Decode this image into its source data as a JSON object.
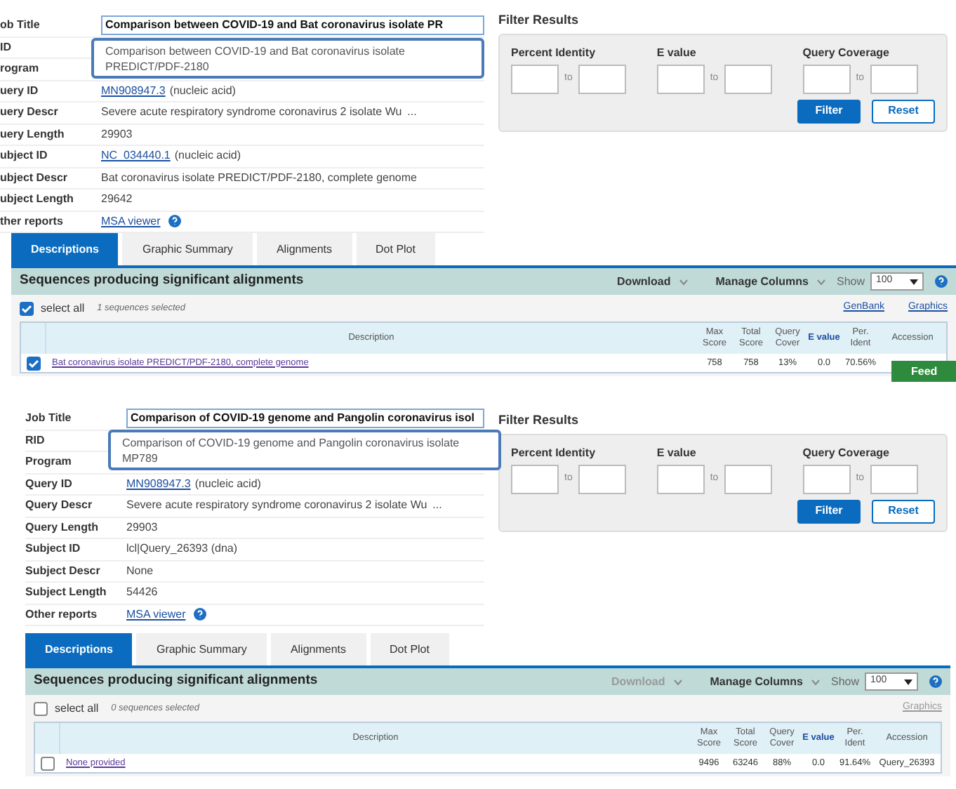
{
  "panels": [
    {
      "details": [
        {
          "label": "ob Title",
          "kind": "input",
          "value": "Comparison between COVID-19 and Bat coronavirus isolate PR"
        },
        {
          "label": "ID",
          "kind": "none"
        },
        {
          "label": "rogram",
          "kind": "none"
        },
        {
          "label": "uery ID",
          "kind": "link",
          "value": "MN908947.3",
          "suffix": "(nucleic acid)"
        },
        {
          "label": "uery Descr",
          "kind": "more",
          "value": "Severe acute respiratory syndrome coronavirus 2 isolate Wu",
          "more": "..."
        },
        {
          "label": "uery Length",
          "kind": "text",
          "value": "29903"
        },
        {
          "label": "ubject ID",
          "kind": "link",
          "value": "NC_034440.1",
          "suffix": "(nucleic acid)"
        },
        {
          "label": "ubject Descr",
          "kind": "text",
          "value": "Bat coronavirus isolate PREDICT/PDF-2180, complete genome"
        },
        {
          "label": "ubject Length",
          "kind": "text",
          "value": "29642"
        },
        {
          "label": "ther reports",
          "kind": "help",
          "value": "MSA viewer"
        }
      ],
      "tooltip": "Comparison between COVID-19 and Bat coronavirus isolate PREDICT/PDF-2180",
      "filter": {
        "title": "Filter Results",
        "groups": [
          {
            "label": "Percent Identity",
            "sep": "to"
          },
          {
            "label": "E value",
            "sep": "to"
          },
          {
            "label": "Query Coverage",
            "sep": "to"
          }
        ],
        "buttons": [
          "Filter",
          "Reset"
        ]
      },
      "tabs": [
        {
          "label": "Descriptions",
          "selected": true
        },
        {
          "label": "Graphic Summary",
          "selected": false
        },
        {
          "label": "Alignments",
          "selected": false
        },
        {
          "label": "Dot Plot",
          "selected": false
        }
      ],
      "results": {
        "title": "Sequences producing significant alignments",
        "download": {
          "label": "Download",
          "disabled": false
        },
        "manage": "Manage Columns",
        "show_label": "Show",
        "show_value": "100",
        "select_all": {
          "label": "select all",
          "checked": true
        },
        "selected_text": "1 sequences selected",
        "links": [
          {
            "label": "GenBank",
            "disabled": false
          },
          {
            "label": "Graphics",
            "disabled": false
          }
        ],
        "columns": [
          "Description",
          "Max Score",
          "Total Score",
          "Query Cover",
          "E value",
          "Per. Ident",
          "Accession"
        ],
        "rows": [
          {
            "checked": true,
            "cells": [
              "Bat coronavirus isolate PREDICT/PDF-2180, complete genome",
              "758",
              "758",
              "13%",
              "0.0",
              "70.56%",
              ""
            ]
          }
        ],
        "feedback": "Feed"
      }
    },
    {
      "details": [
        {
          "label": "Job Title",
          "kind": "input",
          "value": "Comparison of COVID-19 genome and Pangolin coronavirus isol"
        },
        {
          "label": "RID",
          "kind": "none"
        },
        {
          "label": "Program",
          "kind": "none"
        },
        {
          "label": "Query ID",
          "kind": "link",
          "value": "MN908947.3",
          "suffix": "(nucleic acid)"
        },
        {
          "label": "Query Descr",
          "kind": "more",
          "value": "Severe acute respiratory syndrome coronavirus 2 isolate Wu",
          "more": "..."
        },
        {
          "label": "Query Length",
          "kind": "text",
          "value": "29903"
        },
        {
          "label": "Subject ID",
          "kind": "text",
          "value": "lcl|Query_26393 (dna)"
        },
        {
          "label": "Subject Descr",
          "kind": "text",
          "value": "None"
        },
        {
          "label": "Subject Length",
          "kind": "text",
          "value": "54426"
        },
        {
          "label": "Other reports",
          "kind": "help",
          "value": "MSA viewer"
        }
      ],
      "tooltip": "Comparison of COVID-19 genome and Pangolin coronavirus isolate MP789",
      "filter": {
        "title": "Filter Results",
        "groups": [
          {
            "label": "Percent Identity",
            "sep": "to"
          },
          {
            "label": "E value",
            "sep": "to"
          },
          {
            "label": "Query Coverage",
            "sep": "to"
          }
        ],
        "buttons": [
          "Filter",
          "Reset"
        ]
      },
      "tabs": [
        {
          "label": "Descriptions",
          "selected": true
        },
        {
          "label": "Graphic Summary",
          "selected": false
        },
        {
          "label": "Alignments",
          "selected": false
        },
        {
          "label": "Dot Plot",
          "selected": false
        }
      ],
      "results": {
        "title": "Sequences producing significant alignments",
        "download": {
          "label": "Download",
          "disabled": true
        },
        "manage": "Manage Columns",
        "show_label": "Show",
        "show_value": "100",
        "select_all": {
          "label": "select all",
          "checked": false
        },
        "selected_text": "0 sequences selected",
        "links": [
          {
            "label": "Graphics",
            "disabled": true
          }
        ],
        "columns": [
          "Description",
          "Max Score",
          "Total Score",
          "Query Cover",
          "E value",
          "Per. Ident",
          "Accession"
        ],
        "rows": [
          {
            "checked": false,
            "cells": [
              "None provided",
              "9496",
              "63246",
              "88%",
              "0.0",
              "91.64%",
              "Query_26393"
            ]
          }
        ]
      }
    }
  ]
}
